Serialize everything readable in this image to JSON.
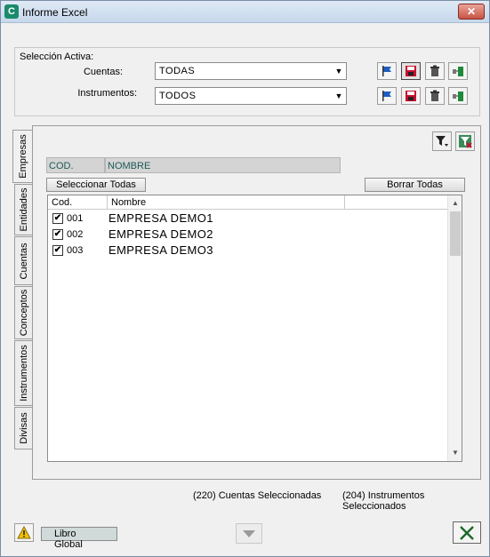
{
  "window": {
    "title": "Informe Excel",
    "app_icon": "C",
    "close_glyph": "✕"
  },
  "seleccion": {
    "label": "Selección Activa:",
    "cuentas": {
      "label": "Cuentas:",
      "value": "TODAS"
    },
    "instrumentos": {
      "label": "Instrumentos:",
      "value": "TODOS"
    }
  },
  "tabs": [
    "Empresas",
    "Entidades",
    "Cuentas",
    "Conceptos",
    "Instrumentos",
    "Divisas"
  ],
  "filter": {
    "cod_label": "COD.",
    "nombre_label": "NOMBRE"
  },
  "buttons": {
    "select_all": "Seleccionar Todas",
    "clear_all": "Borrar Todas"
  },
  "list": {
    "headers": [
      "Cod.",
      "Nombre"
    ],
    "rows": [
      {
        "checked": true,
        "code": "001",
        "name": "EMPRESA DEMO1"
      },
      {
        "checked": true,
        "code": "002",
        "name": "EMPRESA DEMO2"
      },
      {
        "checked": true,
        "code": "003",
        "name": "EMPRESA DEMO3"
      }
    ]
  },
  "status": {
    "cuentas": "(220) Cuentas Seleccionadas",
    "instrumentos": "(204) Instrumentos Seleccionados"
  },
  "footer": {
    "libro": "Libro Global"
  },
  "colors": {
    "accent_teal": "#1d5a58",
    "flag_blue": "#1f5fbf",
    "delete_red": "#c8102e",
    "excel_green": "#1e8a3a"
  }
}
